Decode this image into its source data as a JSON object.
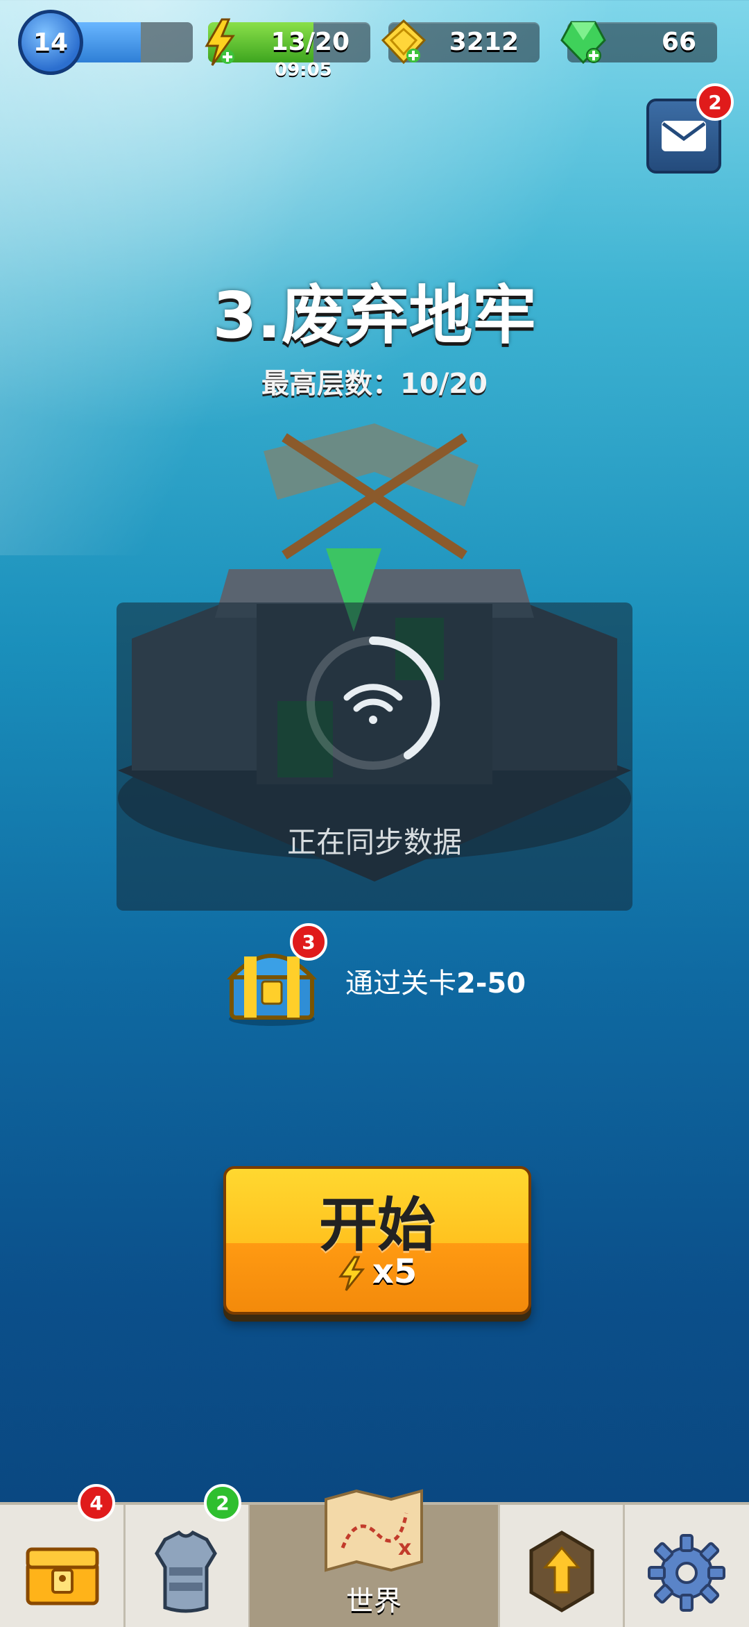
{
  "topbar": {
    "level": "14",
    "xp_progress": 0.6,
    "energy": "13/20",
    "energy_progress": 0.65,
    "energy_timer": "09:05",
    "gold": "3212",
    "gems": "66",
    "mail_badge": "2"
  },
  "stage": {
    "title": "3.废弃地牢",
    "max_floor": "最高层数：10/20"
  },
  "sync": {
    "text": "正在同步数据"
  },
  "reward": {
    "badge": "3",
    "text_prefix": "通过关卡",
    "text_level": "2-50"
  },
  "start_button": {
    "label": "开始",
    "cost": "x5"
  },
  "nav": {
    "chest_badge": "4",
    "armor_badge": "2",
    "world_label": "世界"
  },
  "colors": {
    "start_button_top": "#ffd830",
    "start_button_bottom": "#f38a0b",
    "badge_red": "#e01b1b",
    "badge_green": "#2fbf2f"
  }
}
